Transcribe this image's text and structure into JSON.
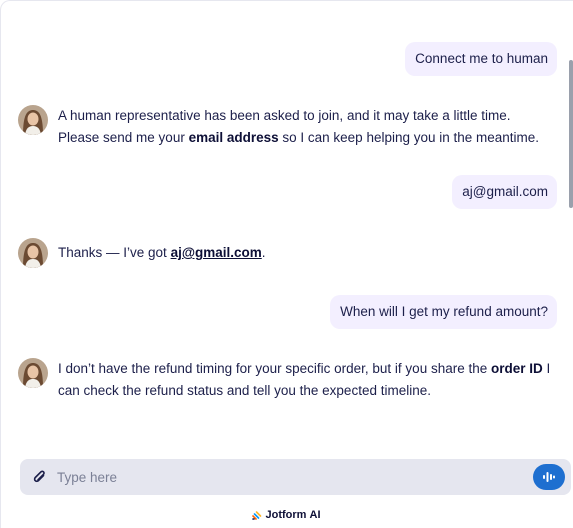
{
  "messages": {
    "user1": "Connect me to human",
    "bot1": {
      "text1": "A human representative has been asked to join, and it may take a little time. Please send me your ",
      "bold": "email address",
      "text2": " so I can keep helping you in the meantime."
    },
    "user2": "aj@gmail.com",
    "bot2": {
      "text1": "Thanks — I’ve got ",
      "link": "aj@gmail.com",
      "text2": "."
    },
    "user3": "When will I get my refund amount?",
    "bot3": {
      "text1": "I don’t have the refund timing for your specific order, but if you share the ",
      "bold": "order ID",
      "text2": " I can check the refund status and tell you the expected timeline."
    }
  },
  "composer": {
    "placeholder": "Type here",
    "attach_icon": "paperclip-icon",
    "voice_icon": "voice-wave-icon"
  },
  "branding": {
    "name": "Jotform",
    "suffix": "AI"
  },
  "colors": {
    "user_bubble": "#f3efff",
    "composer_bg": "#e5e6ef",
    "voice_button": "#1e6fd0",
    "text": "#1c1f4a"
  }
}
